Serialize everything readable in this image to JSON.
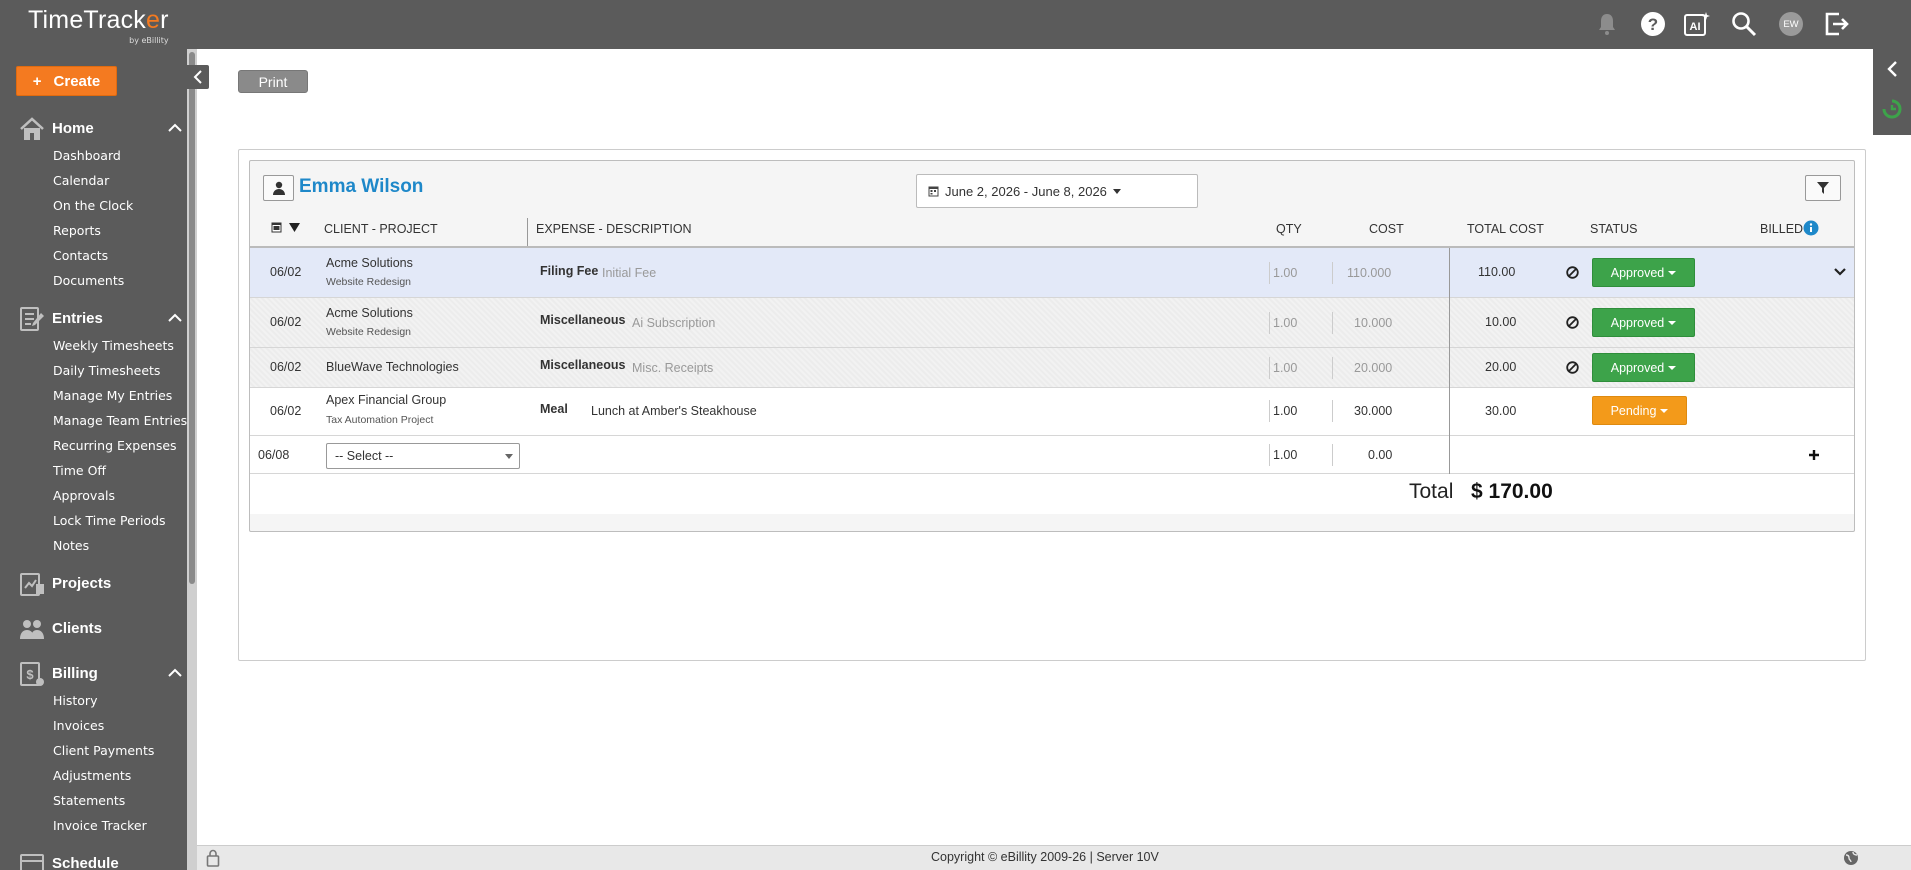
{
  "app": {
    "name_left": "TimeTrack",
    "name_o": "e",
    "name_right": "r",
    "by": "by eBillity"
  },
  "sidebar": {
    "create_label": "Create",
    "sections": {
      "home": {
        "label": "Home",
        "items": [
          "Dashboard",
          "Calendar",
          "On the Clock",
          "Reports",
          "Contacts",
          "Documents"
        ]
      },
      "entries": {
        "label": "Entries",
        "items": [
          "Weekly Timesheets",
          "Daily Timesheets",
          "Manage My Entries",
          "Manage Team Entries",
          "Recurring Expenses",
          "Time Off",
          "Approvals",
          "Lock Time Periods",
          "Notes"
        ]
      },
      "projects": {
        "label": "Projects"
      },
      "clients": {
        "label": "Clients"
      },
      "billing": {
        "label": "Billing",
        "items": [
          "History",
          "Invoices",
          "Client Payments",
          "Adjustments",
          "Statements",
          "Invoice Tracker"
        ]
      },
      "schedule": {
        "label": "Schedule"
      }
    }
  },
  "topbar": {
    "avatar_initials": "EW",
    "ai_label": "AI"
  },
  "toolbar": {
    "print_label": "Print"
  },
  "report": {
    "user_name": "Emma Wilson",
    "date_range": "June 2, 2026 - June 8, 2026",
    "columns": {
      "client_project": "CLIENT - PROJECT",
      "expense_description": "EXPENSE - DESCRIPTION",
      "qty": "QTY",
      "cost": "COST",
      "total_cost": "TOTAL COST",
      "status": "STATUS",
      "billed": "BILLED"
    },
    "rows": [
      {
        "date": "06/02",
        "client": "Acme Solutions",
        "project": "Website Redesign",
        "expense": "Filing Fee",
        "description": "Initial Fee",
        "qty": "1.00",
        "cost": "110.000",
        "total": "110.00",
        "status": "Approved"
      },
      {
        "date": "06/02",
        "client": "Acme Solutions",
        "project": "Website Redesign",
        "expense": "Miscellaneous",
        "description": "Ai Subscription",
        "qty": "1.00",
        "cost": "10.000",
        "total": "10.00",
        "status": "Approved"
      },
      {
        "date": "06/02",
        "client": "BlueWave Technologies",
        "project": "",
        "expense": "Miscellaneous",
        "description": "Misc. Receipts",
        "qty": "1.00",
        "cost": "20.000",
        "total": "20.00",
        "status": "Approved"
      },
      {
        "date": "06/02",
        "client": "Apex Financial Group",
        "project": "Tax Automation Project",
        "expense": "Meal",
        "description": "Lunch at Amber's Steakhouse",
        "qty": "1.00",
        "cost": "30.000",
        "total": "30.00",
        "status": "Pending"
      }
    ],
    "new_row": {
      "date": "06/08",
      "select_placeholder": "-- Select --",
      "qty": "1.00",
      "cost": "0.00"
    },
    "total_label": "Total",
    "total_value": "$ 170.00"
  },
  "footer": {
    "copyright": "Copyright © eBillity 2009-26  |  Server 10V"
  },
  "colors": {
    "accent": "#f47a20",
    "link": "#1e88c9",
    "approved": "#3da34a",
    "pending": "#f39a1a",
    "chrome": "#5b5b5b"
  }
}
